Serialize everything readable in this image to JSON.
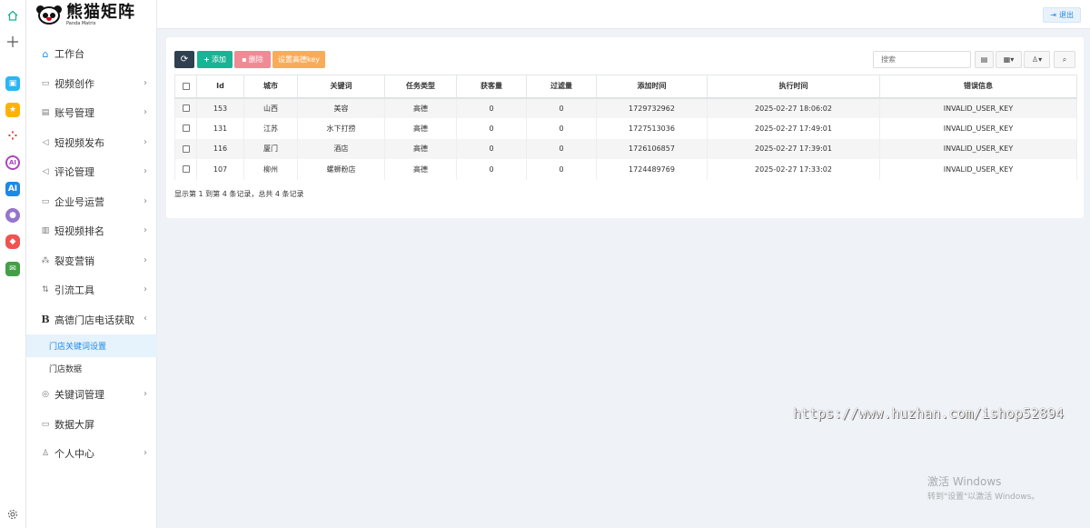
{
  "app": {
    "logo_text": "熊猫矩阵",
    "logo_subtext": "Panda Matrix"
  },
  "header": {
    "logout_label": "退出"
  },
  "sidebar": {
    "items": [
      {
        "label": "工作台",
        "icon": "home-icon"
      },
      {
        "label": "视频创作",
        "icon": "video-icon"
      },
      {
        "label": "账号管理",
        "icon": "account-icon"
      },
      {
        "label": "短视频发布",
        "icon": "send-icon"
      },
      {
        "label": "评论管理",
        "icon": "comment-icon"
      },
      {
        "label": "企业号运营",
        "icon": "enterprise-icon"
      },
      {
        "label": "短视频排名",
        "icon": "bar-chart-icon"
      },
      {
        "label": "裂变营销",
        "icon": "fission-icon"
      },
      {
        "label": "引流工具",
        "icon": "sort-icon"
      },
      {
        "label": "高德门店电话获取",
        "icon": "b-icon"
      },
      {
        "label": "关键词管理",
        "icon": "target-icon"
      },
      {
        "label": "数据大屏",
        "icon": "monitor-icon"
      },
      {
        "label": "个人中心",
        "icon": "user-icon"
      }
    ],
    "sub_items": [
      {
        "label": "门店关键词设置"
      },
      {
        "label": "门店数据"
      }
    ]
  },
  "toolbar": {
    "add_label": "添加",
    "delete_label": "删除",
    "set_key_label": "设置高德key",
    "search_placeholder": "搜索"
  },
  "table": {
    "columns": [
      "Id",
      "城市",
      "关键词",
      "任务类型",
      "获客量",
      "过滤量",
      "添加时间",
      "执行时间",
      "错误信息"
    ],
    "rows": [
      {
        "id": "153",
        "city": "山西",
        "keyword": "美容",
        "type": "高德",
        "acquired": "0",
        "filtered": "0",
        "added": "1729732962",
        "executed": "2025-02-27 18:06:02",
        "error": "INVALID_USER_KEY"
      },
      {
        "id": "131",
        "city": "江苏",
        "keyword": "水下打捞",
        "type": "高德",
        "acquired": "0",
        "filtered": "0",
        "added": "1727513036",
        "executed": "2025-02-27 17:49:01",
        "error": "INVALID_USER_KEY"
      },
      {
        "id": "116",
        "city": "厦门",
        "keyword": "酒店",
        "type": "高德",
        "acquired": "0",
        "filtered": "0",
        "added": "1726106857",
        "executed": "2025-02-27 17:39:01",
        "error": "INVALID_USER_KEY"
      },
      {
        "id": "107",
        "city": "柳州",
        "keyword": "螺蛳粉店",
        "type": "高德",
        "acquired": "0",
        "filtered": "0",
        "added": "1724489769",
        "executed": "2025-02-27 17:33:02",
        "error": "INVALID_USER_KEY"
      }
    ]
  },
  "pagination": {
    "summary": "显示第 1 到第 4 条记录，总共 4 条记录"
  },
  "overlay": {
    "watermark": "https://www.huzhan.com/ishop52894",
    "activate_title": "激活 Windows",
    "activate_hint": "转到\"设置\"以激活 Windows。"
  },
  "colors": {
    "primary": "#1ab394",
    "danger": "#ed5565",
    "warning": "#f8ac59",
    "dark": "#2f4050",
    "link": "#1e88e5"
  }
}
